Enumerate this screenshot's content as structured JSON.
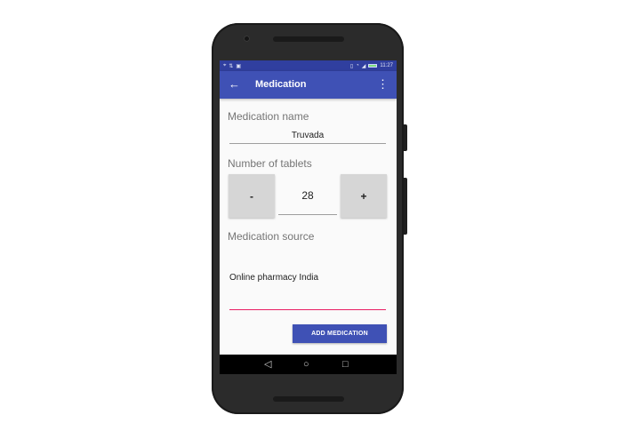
{
  "status_bar": {
    "time": "11:27"
  },
  "app_bar": {
    "title": "Medication",
    "back_icon": "arrow-left-icon",
    "menu_icon": "more-vert-icon"
  },
  "form": {
    "name_label": "Medication name",
    "name_value": "Truvada",
    "tablets_label": "Number of tablets",
    "decrement_label": "-",
    "increment_label": "+",
    "tablets_value": "28",
    "source_label": "Medication source",
    "source_value": "Online pharmacy India",
    "add_button_label": "ADD MEDICATION"
  },
  "colors": {
    "primary": "#3f51b5",
    "primary_dark": "#303f9f",
    "accent": "#e91e63"
  }
}
